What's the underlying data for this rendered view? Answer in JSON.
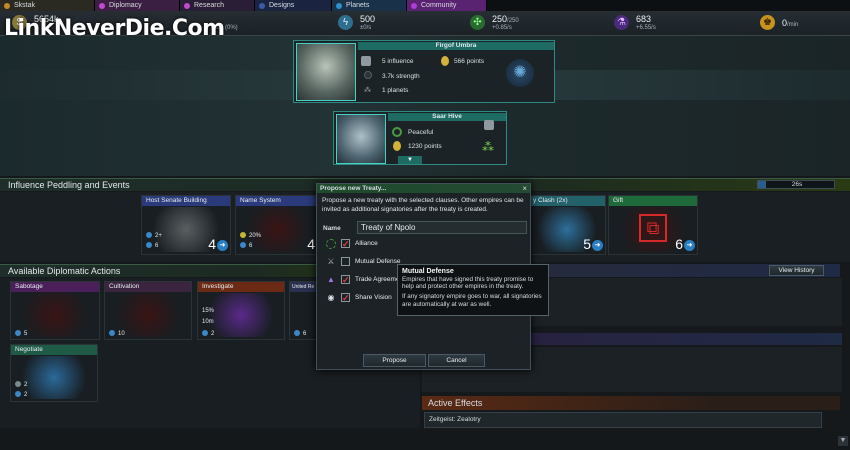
{
  "tabs": [
    {
      "label": "Skstak",
      "color": "#c38a2c",
      "bg": "#2b2a22"
    },
    {
      "label": "Diplomacy",
      "color": "#c24ad0",
      "bg": "#3a1f42"
    },
    {
      "label": "Research",
      "color": "#c24ad0",
      "bg": "#2a1e36"
    },
    {
      "label": "Designs",
      "color": "#3a5ca8",
      "bg": "#1a2440"
    },
    {
      "label": "Planets",
      "color": "#2f8fd1",
      "bg": "#19324a"
    },
    {
      "label": "Community",
      "color": "#b03bd8",
      "bg": "#5a2372"
    }
  ],
  "resources": {
    "money": {
      "value": "5654k",
      "sub": "/min (0%)"
    },
    "energy": {
      "value": "500",
      "sub": "±0/s"
    },
    "labor": {
      "value": "250",
      "max": "/250",
      "sub": "+0.85/s"
    },
    "research": {
      "value": "683",
      "sub": "+6.55/s"
    },
    "influence": {
      "value": "0",
      "sub": "/min"
    }
  },
  "watermark": "LinkNeverDie.Com",
  "empire1": {
    "name": "Firgof Umbra",
    "influence": "5 influence",
    "points": "566 points",
    "strength": "3.7k strength",
    "planets": "1 planets"
  },
  "empire2": {
    "name": "Saar Hive",
    "status": "Peaceful",
    "points": "1230 points"
  },
  "influence_section": {
    "title": "Influence Peddling and Events",
    "timer": "26s"
  },
  "influence_cards": [
    {
      "title": "Host Senate Building",
      "cost1": "2+",
      "cost2": "6",
      "count": "4"
    },
    {
      "title": "Name System",
      "cost1": "20%",
      "cost2": "6",
      "count": "4"
    },
    {
      "title": "y Clash (2x)",
      "cost1": "",
      "cost2": "",
      "count": "5"
    },
    {
      "title": "Gift",
      "cost1": "",
      "cost2": "",
      "count": "6"
    }
  ],
  "diplo_section": {
    "title": "Available Diplomatic Actions",
    "view_history": "View History"
  },
  "diplo_cards": [
    {
      "title": "Sabotage",
      "cost": "5"
    },
    {
      "title": "Cultivation",
      "cost": "10"
    },
    {
      "title": "Investigate",
      "cost": "2",
      "extra1": "15%",
      "extra2": "10m"
    },
    {
      "title": "United Re",
      "cost": "6"
    },
    {
      "title": "Negotiate",
      "cost": "2",
      "cost2": "2"
    }
  ],
  "active_effects": {
    "title": "Active Effects",
    "items": [
      "Zeitgeist: Zealotry"
    ]
  },
  "dialog": {
    "title": "Propose new Treaty...",
    "close": "×",
    "description": "Propose a new treaty with the selected clauses. Other empires can be invited as additional signatories after the treaty is created.",
    "name_label": "Name",
    "name_value": "Treaty of Npolo",
    "clauses": [
      {
        "label": "Alliance",
        "checked": true
      },
      {
        "label": "Mutual Defense",
        "checked": false
      },
      {
        "label": "Trade Agreement",
        "checked": true
      },
      {
        "label": "Share Vision",
        "checked": true
      }
    ],
    "propose": "Propose",
    "cancel": "Cancel"
  },
  "tooltip": {
    "title": "Mutual Defense",
    "line1": "Empires that have signed this treaty promise to help and protect other empires in the treaty.",
    "line2": "If any signatory empire goes to war, all signatories are automatically at war as well."
  }
}
